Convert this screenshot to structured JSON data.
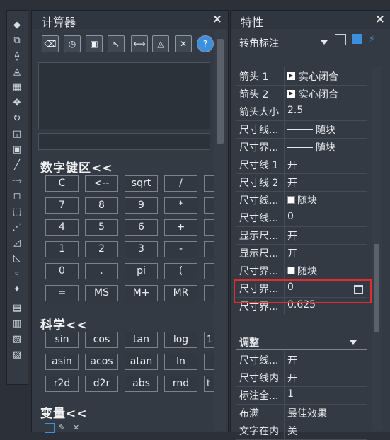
{
  "toolbar": {
    "tools": [
      "erase-icon",
      "copy-icon",
      "mirror-icon",
      "offset-icon",
      "array-icon",
      "move-icon",
      "rotate-icon",
      "scale-icon",
      "stretch-icon",
      "trim-icon",
      "extend-icon",
      "break-at-point-icon",
      "break-icon",
      "join-icon",
      "chamfer-icon",
      "fillet-icon",
      "blend-icon",
      "explode-icon",
      "draw-order-icon",
      "bring-to-front-icon",
      "send-to-back-icon",
      "bring-above-icon"
    ]
  },
  "calc": {
    "title": "计算器",
    "close": "×",
    "toolbar_buttons": [
      "clear-icon",
      "history-icon",
      "get-coordinates-icon",
      "distance-icon",
      "line-angle-icon",
      "intersection-icon",
      "clear-history-icon",
      "help-icon"
    ],
    "numpad": {
      "header": "数字键区<<",
      "rows": [
        [
          "C",
          "<--",
          "sqrt",
          "/"
        ],
        [
          "7",
          "8",
          "9",
          "*"
        ],
        [
          "4",
          "5",
          "6",
          "+"
        ],
        [
          "1",
          "2",
          "3",
          "-"
        ],
        [
          "0",
          ".",
          "pi",
          "("
        ],
        [
          "=",
          "MS",
          "M+",
          "MR"
        ]
      ],
      "cut_col": [
        "",
        "",
        "",
        "",
        "",
        ""
      ]
    },
    "science": {
      "header": "科学<<",
      "rows": [
        [
          "sin",
          "cos",
          "tan",
          "log"
        ],
        [
          "asin",
          "acos",
          "atan",
          "ln"
        ],
        [
          "r2d",
          "d2r",
          "abs",
          "rnd"
        ]
      ],
      "cut_col": [
        "1",
        "",
        "t"
      ]
    },
    "variables": {
      "header": "变量<<"
    }
  },
  "props": {
    "title": "特性",
    "close": "×",
    "object_type": "转角标注",
    "rows": [
      {
        "label": "箭头 1",
        "value": "实心闭合",
        "icon": "arrow"
      },
      {
        "label": "箭头 2",
        "value": "实心闭合",
        "icon": "arrow"
      },
      {
        "label": "箭头大小",
        "value": "2.5"
      },
      {
        "label": "尺寸线...",
        "value": "随块",
        "icon": "line"
      },
      {
        "label": "尺寸界...",
        "value": "随块",
        "icon": "line"
      },
      {
        "label": "尺寸线 1",
        "value": "开"
      },
      {
        "label": "尺寸线 2",
        "value": "开"
      },
      {
        "label": "尺寸线...",
        "value": "随块",
        "icon": "swatch"
      },
      {
        "label": "尺寸线...",
        "value": "0"
      },
      {
        "label": "显示尺...",
        "value": "开"
      },
      {
        "label": "显示尺...",
        "value": "开"
      },
      {
        "label": "尺寸界...",
        "value": "随块",
        "icon": "swatch"
      },
      {
        "label": "尺寸界...",
        "value": "0",
        "highlight": true
      },
      {
        "label": "尺寸界...",
        "value": "0.625"
      }
    ],
    "section2": "调整",
    "rows2": [
      {
        "label": "尺寸线...",
        "value": "开"
      },
      {
        "label": "尺寸线内",
        "value": "开"
      },
      {
        "label": "标注全...",
        "value": "1"
      },
      {
        "label": "布满",
        "value": "最佳效果"
      },
      {
        "label": "文字在内",
        "value": "关"
      }
    ]
  },
  "colors": {
    "highlight_border": "#e02d2d",
    "accent": "#3b8fdd"
  }
}
